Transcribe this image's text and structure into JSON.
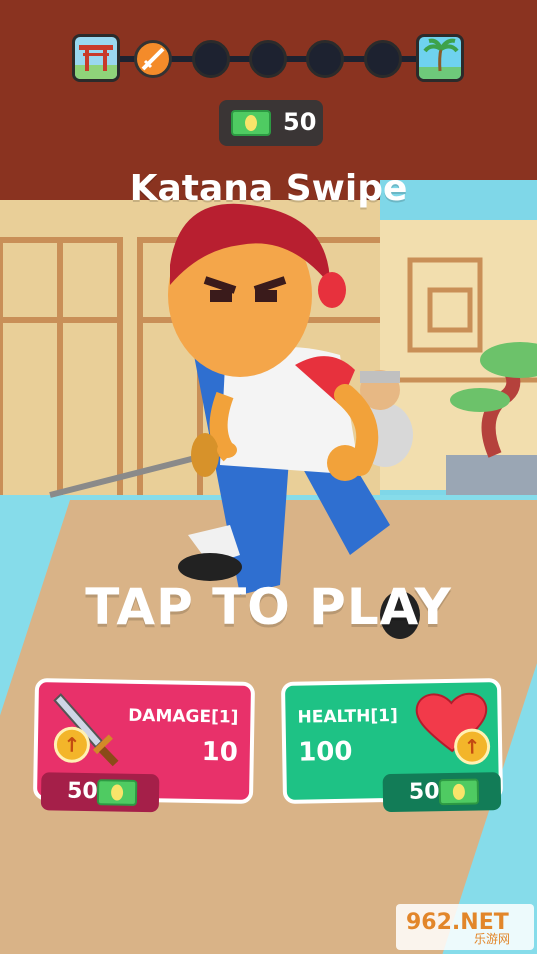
{
  "level_progress": {
    "start_icon": "torii-gate-icon",
    "end_icon": "palm-tree-icon",
    "current_stage_icon": "katana-icon",
    "total_stages": 5,
    "completed_stages": 1
  },
  "currency": {
    "amount": "50",
    "icon": "cash-bill-icon"
  },
  "weapon_name": "Katana Swipe",
  "prompt": "TAP TO PLAY",
  "upgrades": [
    {
      "label": "DAMAGE[1]",
      "value": "10",
      "price": "50",
      "icon": "sword-icon",
      "color": "#e8316a"
    },
    {
      "label": "HEALTH[1]",
      "value": "100",
      "price": "50",
      "icon": "heart-icon",
      "color": "#1ec285"
    }
  ],
  "watermark": {
    "text": "962.NET",
    "sub": "乐游网"
  }
}
